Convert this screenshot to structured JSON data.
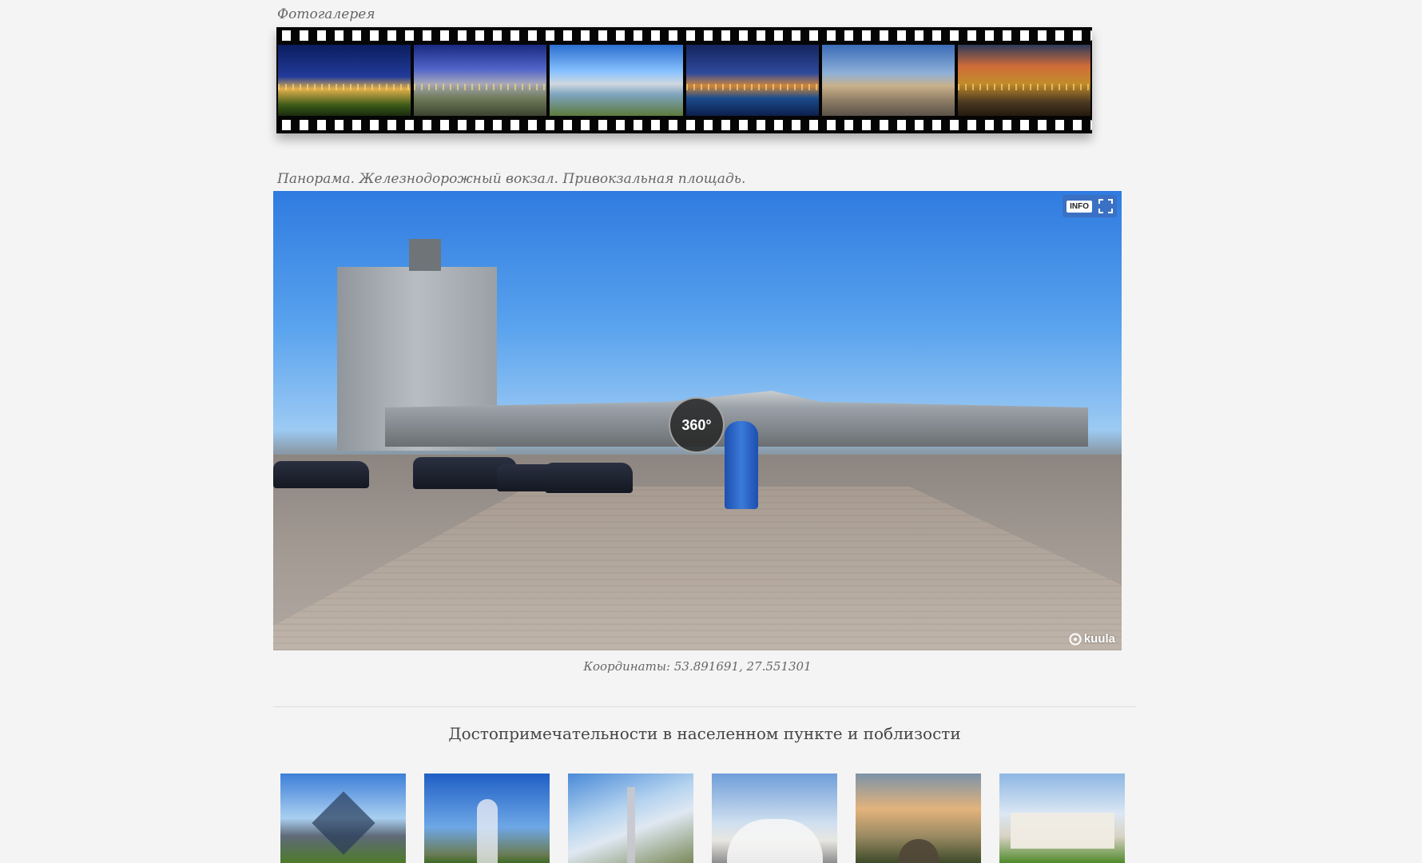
{
  "gallery": {
    "caption": "Фотогалерея",
    "frames": [
      "photo-1",
      "photo-2",
      "photo-3",
      "photo-4",
      "photo-5",
      "photo-6"
    ]
  },
  "panorama": {
    "caption": "Панорама. Железнодорожный вокзал. Привокзальная площадь.",
    "badge_360": "360°",
    "info_label": "INFO",
    "brand": "kuula"
  },
  "coordinates": "Координаты: 53.891691, 27.551301",
  "attractions": {
    "title": "Достопримечательности в населенном пункте и поблизости",
    "items": [
      "attraction-1",
      "attraction-2",
      "attraction-3",
      "attraction-4",
      "attraction-5",
      "attraction-6"
    ]
  }
}
